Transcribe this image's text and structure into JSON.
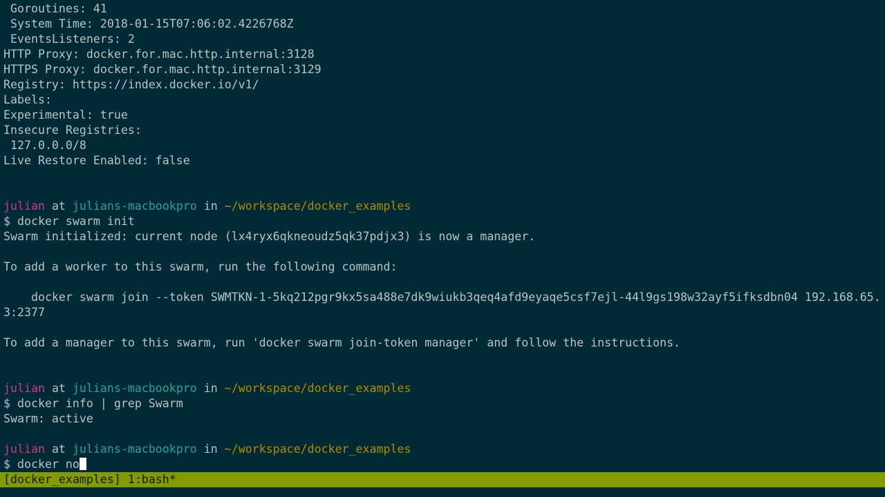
{
  "output_top": [
    " Goroutines: 41",
    " System Time: 2018-01-15T07:06:02.4226768Z",
    " EventsListeners: 2",
    "HTTP Proxy: docker.for.mac.http.internal:3128",
    "HTTPS Proxy: docker.for.mac.http.internal:3129",
    "Registry: https://index.docker.io/v1/",
    "Labels:",
    "Experimental: true",
    "Insecure Registries:",
    " 127.0.0.0/8",
    "Live Restore Enabled: false"
  ],
  "prompt": {
    "user": "julian",
    "at": " at ",
    "host": "julians-macbookpro",
    "in": " in ",
    "path": "~/workspace/docker_examples",
    "symbol": "$ "
  },
  "commands": {
    "swarm_init": "docker swarm init",
    "info_grep": "docker info | grep Swarm",
    "current_input": "docker no"
  },
  "output_swarm_init": [
    "Swarm initialized: current node (lx4ryx6qkneoudz5qk37pdjx3) is now a manager.",
    "",
    "To add a worker to this swarm, run the following command:",
    "",
    "    docker swarm join --token SWMTKN-1-5kq212pgr9kx5sa488e7dk9wiukb3qeq4afd9eyaqe5csf7ejl-44l9gs198w32ayf5ifksdbn04 192.168.65.",
    "3:2377",
    "",
    "To add a manager to this swarm, run 'docker swarm join-token manager' and follow the instructions."
  ],
  "output_info_grep": [
    "Swarm: active"
  ],
  "statusbar": {
    "label": "[docker_examples] 1:bash*"
  },
  "colors": {
    "background": "#002b36",
    "text": "#b9c4c4",
    "user": "#d33682",
    "host": "#2aa198",
    "path": "#b58900",
    "statusbar_bg": "#859900"
  }
}
